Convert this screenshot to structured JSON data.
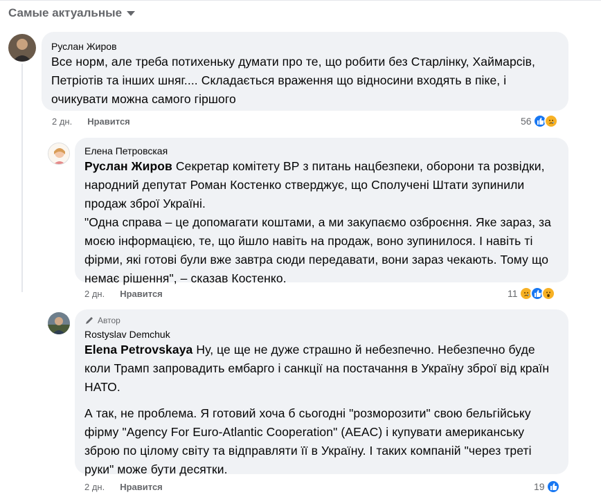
{
  "header": {
    "sort_label": "Самые актуальные"
  },
  "comments": [
    {
      "author": "Руслан Жиров",
      "text": "Все норм, але треба потихеньку думати про те, що робити без Старлінку, Хаймарсів, Петріотів та інших шняг.... Складається враження що відносини входять в піке, і очикувати можна самого гіршого",
      "time": "2 дн.",
      "like_label": "Нравится",
      "reaction_count": "56",
      "reactions": [
        "like-icon",
        "sad-icon"
      ]
    },
    {
      "author": "Елена Петровская",
      "mention": "Руслан Жиров",
      "text_after_mention": " Секретар комітету ВР з питань нацбезпеки, оборони та розвідки, народний депутат Роман Костенко стверджує, що Сполучені Штати зупинили продаж зброї Україні.",
      "quote": "\"Одна справа – це допомагати коштами, а ми закупаємо озброєння. Яке зараз, за моєю інформацією, те, що йшло навіть на продаж, воно зупинилося. І навіть ті фірми, які готові були вже завтра сюди передавати, вони зараз чекають. Тому що немає рішення\", – сказав Костенко.",
      "time": "2 дн.",
      "like_label": "Нравится",
      "reaction_count": "11",
      "reactions": [
        "sad-icon",
        "like-icon",
        "wow-icon"
      ]
    },
    {
      "author_badge": "Автор",
      "author": "Rostyslav Demchuk",
      "mention": "Elena Petrovskaya",
      "text_after_mention": " Ну, це ще не дуже страшно й небезпечно. Небезпечно буде коли Трамп запровадить ембарго і санкції на постачання в Україну зброї від країн НАТО.",
      "paragraph2": "А так, не проблема. Я готовий хоча б сьогодні \"розморозити\" свою бельгійську фірму \"Agency For Euro-Atlantic Cooperation\" (AEAC) і купувати американську зброю по цілому світу та відправляти її в Україну. І таких компаній \"через треті руки\" може бути десятки.",
      "time": "2 дн.",
      "like_label": "Нравится",
      "reaction_count": "19",
      "reactions": [
        "like-icon"
      ]
    }
  ],
  "colors": {
    "like": "#1877f2",
    "emoji": "#f7b125",
    "bubble": "#f0f2f5",
    "meta": "#65676b"
  }
}
